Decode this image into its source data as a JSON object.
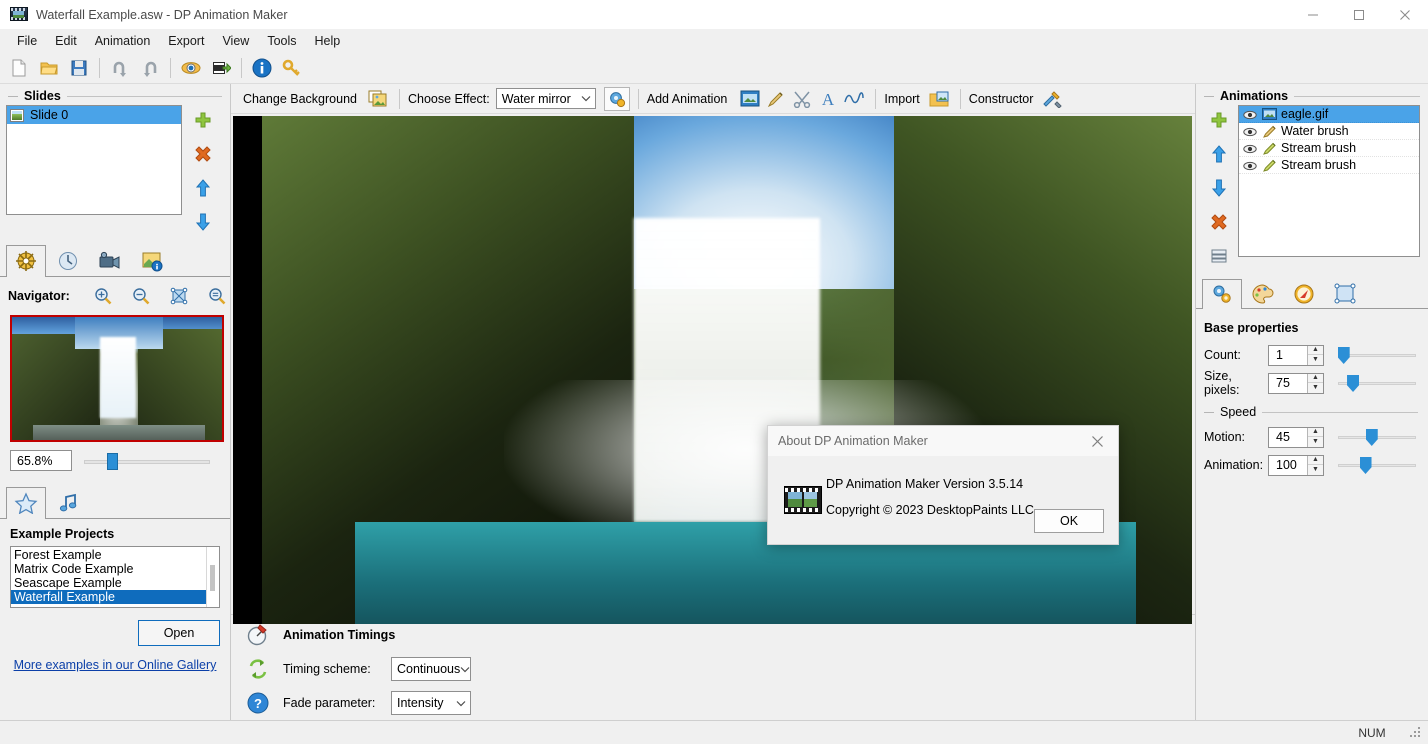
{
  "window": {
    "title": "Waterfall Example.asw - DP Animation Maker",
    "icon": "app-film-icon",
    "controls": {
      "minimize": "minimize-icon",
      "maximize": "maximize-icon",
      "close": "close-icon"
    }
  },
  "menubar": {
    "items": [
      {
        "label": "File"
      },
      {
        "label": "Edit"
      },
      {
        "label": "Animation"
      },
      {
        "label": "Export"
      },
      {
        "label": "View"
      },
      {
        "label": "Tools"
      },
      {
        "label": "Help"
      }
    ]
  },
  "toolbar": {
    "buttons": [
      {
        "name": "new-icon"
      },
      {
        "name": "open-folder-icon"
      },
      {
        "name": "save-icon"
      },
      {
        "name": "undo-icon"
      },
      {
        "name": "redo-icon"
      },
      {
        "name": "preview-eye-icon"
      },
      {
        "name": "export-video-icon"
      },
      {
        "name": "info-icon"
      },
      {
        "name": "key-icon"
      }
    ]
  },
  "left_panel": {
    "slides": {
      "title": "Slides",
      "items": [
        {
          "label": "Slide 0",
          "selected": true
        }
      ],
      "buttons": [
        {
          "name": "add-slide-button"
        },
        {
          "name": "delete-slide-button"
        },
        {
          "name": "move-slide-up-button"
        },
        {
          "name": "move-slide-down-button"
        },
        {
          "name": "slide-properties-button"
        }
      ]
    },
    "tabs": [
      {
        "name": "tab-navigator",
        "icon": "compass-icon",
        "active": true
      },
      {
        "name": "tab-timing",
        "icon": "clock-icon",
        "active": false
      },
      {
        "name": "tab-video",
        "icon": "camcorder-icon",
        "active": false
      },
      {
        "name": "tab-image-info",
        "icon": "image-info-icon",
        "active": false
      }
    ],
    "navigator": {
      "label": "Navigator:",
      "zoom_buttons": [
        {
          "name": "zoom-in-icon"
        },
        {
          "name": "zoom-out-icon"
        },
        {
          "name": "fit-to-window-icon"
        },
        {
          "name": "actual-size-icon"
        }
      ],
      "zoom_value": "65.8%",
      "slider_percent": 22
    },
    "lower_tabs": [
      {
        "name": "tab-examples",
        "icon": "star-icon",
        "active": true
      },
      {
        "name": "tab-music",
        "icon": "music-note-icon",
        "active": false
      }
    ],
    "examples": {
      "title": "Example Projects",
      "items": [
        {
          "label": "Forest Example",
          "selected": false
        },
        {
          "label": "Matrix Code Example",
          "selected": false
        },
        {
          "label": "Seascape Example",
          "selected": false
        },
        {
          "label": "Waterfall Example",
          "selected": true
        }
      ],
      "open_button": "Open",
      "gallery_link": "More examples in our Online Gallery"
    }
  },
  "effects_bar": {
    "change_background": "Change Background",
    "change_background_icon": "picture-swap-icon",
    "choose_effect_label": "Choose Effect:",
    "effect_value": "Water mirror",
    "effect_settings_icon": "effect-gear-icon",
    "add_animation_label": "Add Animation",
    "add_animation_icons": [
      {
        "name": "add-gif-animation-icon"
      },
      {
        "name": "brush-animation-icon"
      },
      {
        "name": "scissors-animation-icon"
      },
      {
        "name": "text-animation-icon"
      },
      {
        "name": "wave-animation-icon"
      }
    ],
    "import_label": "Import",
    "import_icon": "import-image-icon",
    "constructor_label": "Constructor",
    "constructor_icon": "constructor-tools-icon"
  },
  "dialog": {
    "title": "About DP Animation Maker",
    "close_icon": "close-icon",
    "app_icon": "film-reel-icon",
    "line1": "DP Animation Maker Version 3.5.14",
    "line2": "Copyright © 2023 DesktopPaints LLC",
    "ok_button": "OK"
  },
  "timings": {
    "title": "Animation Timings",
    "title_icon": "stopwatch-icon",
    "timing_scheme_icon": "loop-arrows-icon",
    "timing_scheme_label": "Timing scheme:",
    "timing_scheme_value": "Continuous",
    "fade_icon": "help-question-icon",
    "fade_label": "Fade parameter:",
    "fade_value": "Intensity"
  },
  "right_panel": {
    "animations": {
      "title": "Animations",
      "items": [
        {
          "label": "eagle.gif",
          "icon": "gif-animation-icon",
          "visible_icon": "eye-icon",
          "selected": true
        },
        {
          "label": "Water brush",
          "icon": "brush-icon",
          "visible_icon": "eye-icon",
          "selected": false
        },
        {
          "label": "Stream brush",
          "icon": "brush-icon",
          "visible_icon": "eye-icon",
          "selected": false
        },
        {
          "label": "Stream brush",
          "icon": "brush-icon",
          "visible_icon": "eye-icon",
          "selected": false
        }
      ],
      "buttons": [
        {
          "name": "add-animation-button"
        },
        {
          "name": "move-animation-up-button"
        },
        {
          "name": "move-animation-down-button"
        },
        {
          "name": "delete-animation-button"
        },
        {
          "name": "animation-list-options-button"
        }
      ]
    },
    "tabs": [
      {
        "name": "tab-base-properties",
        "icon": "gears-icon",
        "active": true
      },
      {
        "name": "tab-color",
        "icon": "palette-icon",
        "active": false
      },
      {
        "name": "tab-direction",
        "icon": "compass-dial-icon",
        "active": false
      },
      {
        "name": "tab-area",
        "icon": "selection-frame-icon",
        "active": false
      }
    ],
    "base_properties": {
      "title": "Base properties",
      "count": {
        "label": "Count:",
        "value": "1",
        "slider_percent": 6
      },
      "size": {
        "label": "Size, pixels:",
        "value": "75",
        "slider_percent": 18
      },
      "speed_group": "Speed",
      "motion": {
        "label": "Motion:",
        "value": "45",
        "slider_percent": 42
      },
      "animation": {
        "label": "Animation:",
        "value": "100",
        "slider_percent": 34
      }
    }
  },
  "statusbar": {
    "num": "NUM"
  }
}
